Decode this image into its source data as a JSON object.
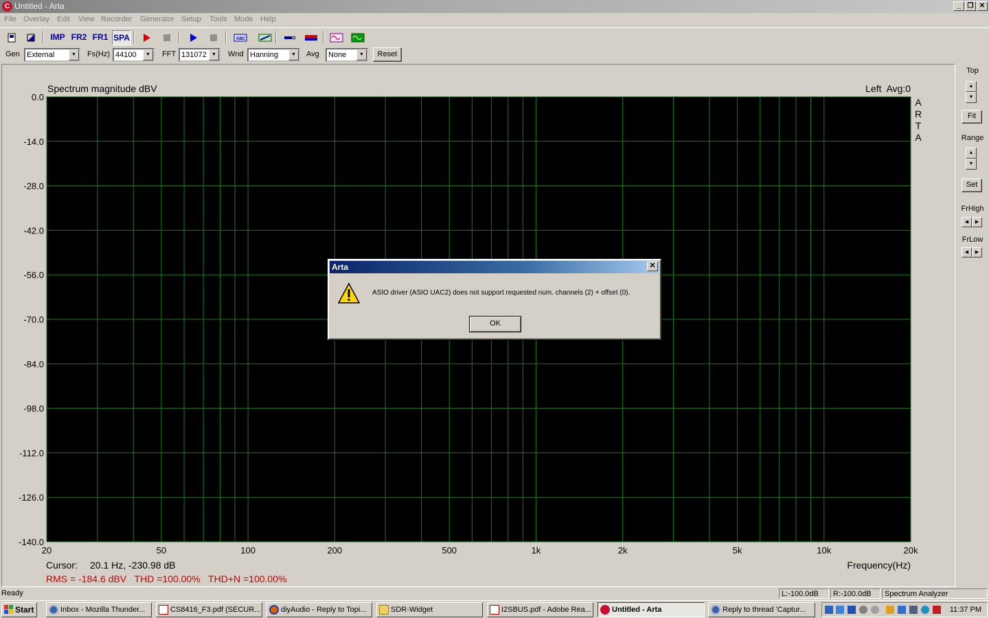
{
  "window": {
    "title": "Untitled - Arta",
    "app_icon": "C"
  },
  "menu": [
    "File",
    "Overlay",
    "Edit",
    "View",
    "Recorder",
    "Generator",
    "Setup",
    "Tools",
    "Mode",
    "Help"
  ],
  "toolbar": {
    "imp": "IMP",
    "fr2": "FR2",
    "fr1": "FR1",
    "spa": "SPA"
  },
  "settings": {
    "gen_label": "Gen",
    "gen_value": "External",
    "fs_label": "Fs(Hz)",
    "fs_value": "44100",
    "fft_label": "FFT",
    "fft_value": "131072",
    "wnd_label": "Wnd",
    "wnd_value": "Hanning",
    "avg_label": "Avg",
    "avg_value": "None",
    "reset_label": "Reset"
  },
  "plot": {
    "title": "Spectrum magnitude dBV",
    "channel_info": "Left  Avg:0",
    "brand": [
      "A",
      "R",
      "T",
      "A"
    ],
    "x_label": "Frequency(Hz)",
    "cursor_label": "Cursor:",
    "cursor_value": "20.1 Hz, -230.98 dB",
    "rms_line": "RMS = -184.6 dBV   THD =100.00%   THD+N =100.00%",
    "colors": {
      "background": "#000000",
      "grid": "#1a7a1a",
      "axis_text": "#000000",
      "rms_text": "#cc0000"
    }
  },
  "chart_data": {
    "type": "line",
    "title": "Spectrum magnitude dBV",
    "xlabel": "Frequency(Hz)",
    "ylabel": "",
    "x_scale": "log",
    "xlim": [
      20,
      20000
    ],
    "ylim": [
      -140,
      0
    ],
    "x_ticks": [
      {
        "v": 20,
        "label": "20"
      },
      {
        "v": 50,
        "label": "50"
      },
      {
        "v": 100,
        "label": "100"
      },
      {
        "v": 200,
        "label": "200"
      },
      {
        "v": 500,
        "label": "500"
      },
      {
        "v": 1000,
        "label": "1k"
      },
      {
        "v": 2000,
        "label": "2k"
      },
      {
        "v": 5000,
        "label": "5k"
      },
      {
        "v": 10000,
        "label": "10k"
      },
      {
        "v": 20000,
        "label": "20k"
      }
    ],
    "y_ticks": [
      0,
      -14,
      -28,
      -42,
      -56,
      -70,
      -84,
      -98,
      -112,
      -126,
      -140
    ],
    "y_tick_labels": [
      "0.0",
      "-14.0",
      "-28.0",
      "-42.0",
      "-56.0",
      "-70.0",
      "-84.0",
      "-98.0",
      "-112.0",
      "-126.0",
      "-140.0"
    ],
    "grid": true,
    "series": []
  },
  "right_panel": {
    "top": "Top",
    "fit": "Fit",
    "range": "Range",
    "set": "Set",
    "frhigh": "FrHigh",
    "frlow": "FrLow"
  },
  "status": {
    "ready": "Ready",
    "left_level": "L:-100.0dB",
    "right_level": "R:-100.0dB",
    "mode": "Spectrum Analyzer"
  },
  "taskbar": {
    "start": "Start",
    "tasks": [
      "Inbox - Mozilla Thunder...",
      "CS8416_F3.pdf (SECUR...",
      "diyAudio - Reply to Topi...",
      "SDR-Widget",
      "I2SBUS.pdf - Adobe Rea...",
      "Untitled - Arta",
      "Reply to thread 'Captur..."
    ],
    "clock": "11:37 PM"
  },
  "dialog": {
    "title": "Arta",
    "message": "ASIO driver (ASIO UAC2) does not support requested num. channels (2) + offset (0).",
    "ok_label": "OK"
  }
}
